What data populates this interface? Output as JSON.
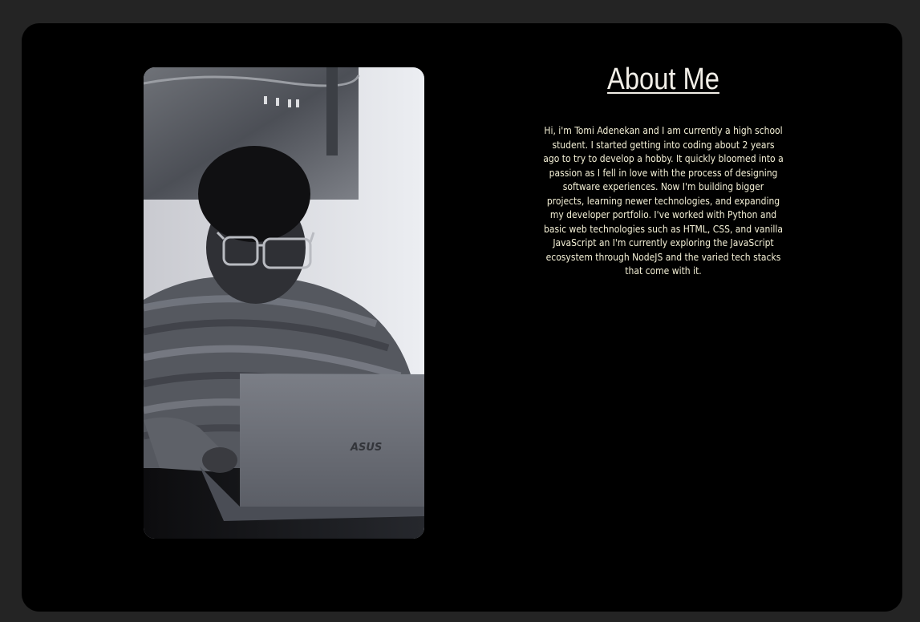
{
  "about": {
    "heading": "About Me",
    "bio": "Hi, i'm Tomi Adenekan and I am currently a high school student. I started getting into coding about 2 years ago to try to develop a hobby. It quickly bloomed into a passion as I fell in love with the process of designing software experiences. Now I'm building bigger projects, learning newer technologies, and expanding my developer portfolio. I've worked with Python and basic web technologies such as HTML, CSS, and vanilla JavaScript an I'm currently exploring the JavaScript ecosystem through NodeJS and the varied tech stacks that come with it."
  },
  "photo": {
    "laptop_brand": "ASUS"
  },
  "colors": {
    "page_background": "#242424",
    "card_background": "#000000",
    "text": "#f2efe8"
  }
}
